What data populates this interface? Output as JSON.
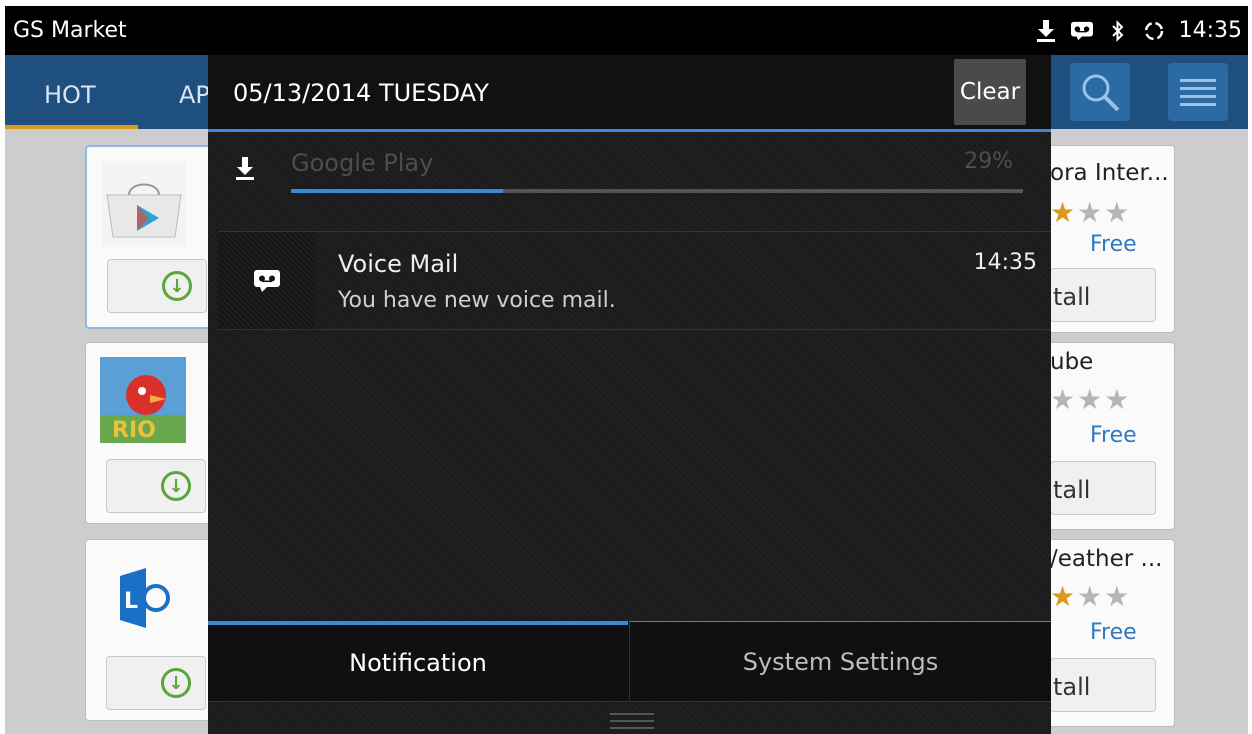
{
  "status_bar": {
    "app_name": "GS Market",
    "time": "14:35"
  },
  "app": {
    "tabs": [
      "HOT",
      "AP"
    ],
    "cards_right": [
      {
        "title": "ora Inter...",
        "price": "Free",
        "install": "tall",
        "rating": 1
      },
      {
        "title": "ube",
        "price": "Free",
        "install": "tall",
        "rating": 0
      },
      {
        "title": "/eather ...",
        "price": "Free",
        "install": "tall",
        "rating": 1
      }
    ]
  },
  "panel": {
    "date": "05/13/2014 TUESDAY",
    "clear_label": "Clear",
    "download": {
      "title": "Google Play",
      "percent_text": "29%",
      "progress": 0.29
    },
    "voicemail": {
      "title": "Voice Mail",
      "subtitle": "You have new voice mail.",
      "time": "14:35"
    },
    "tabs": {
      "notification": "Notification",
      "system_settings": "System Settings"
    }
  },
  "colors": {
    "accent": "#3a88d8",
    "appbar": "#1e4f7e",
    "install_green": "#5ba53b",
    "star_gold": "#d79b1a"
  }
}
